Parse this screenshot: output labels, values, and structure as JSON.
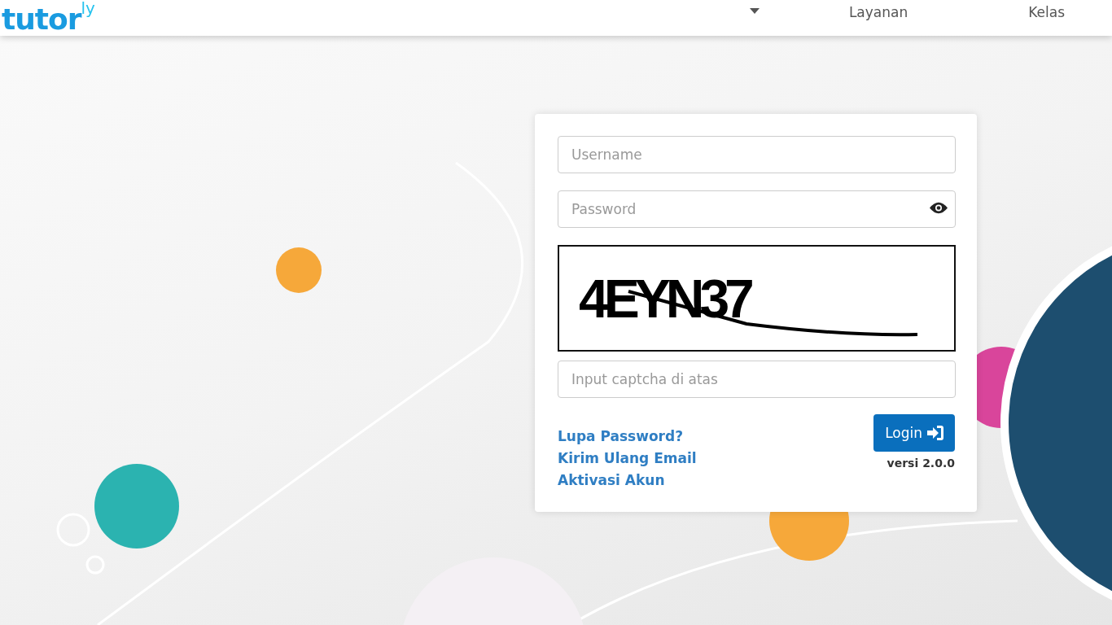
{
  "header": {
    "logo": {
      "main": "tutor",
      "suffix": "ly"
    },
    "nav": [
      {
        "kind": "dropdown"
      },
      {
        "kind": "link",
        "label": "Layanan"
      },
      {
        "kind": "link",
        "label": "Kelas"
      }
    ]
  },
  "login": {
    "username": {
      "placeholder": "Username"
    },
    "password": {
      "placeholder": "Password"
    },
    "captcha": {
      "text": "4EYN37"
    },
    "captcha_input": {
      "placeholder": "Input captcha di atas"
    },
    "links": [
      "Lupa Password?",
      "Kirim Ulang Email",
      "Aktivasi Akun"
    ],
    "button": "Login",
    "version": "versi 2.0.0"
  }
}
